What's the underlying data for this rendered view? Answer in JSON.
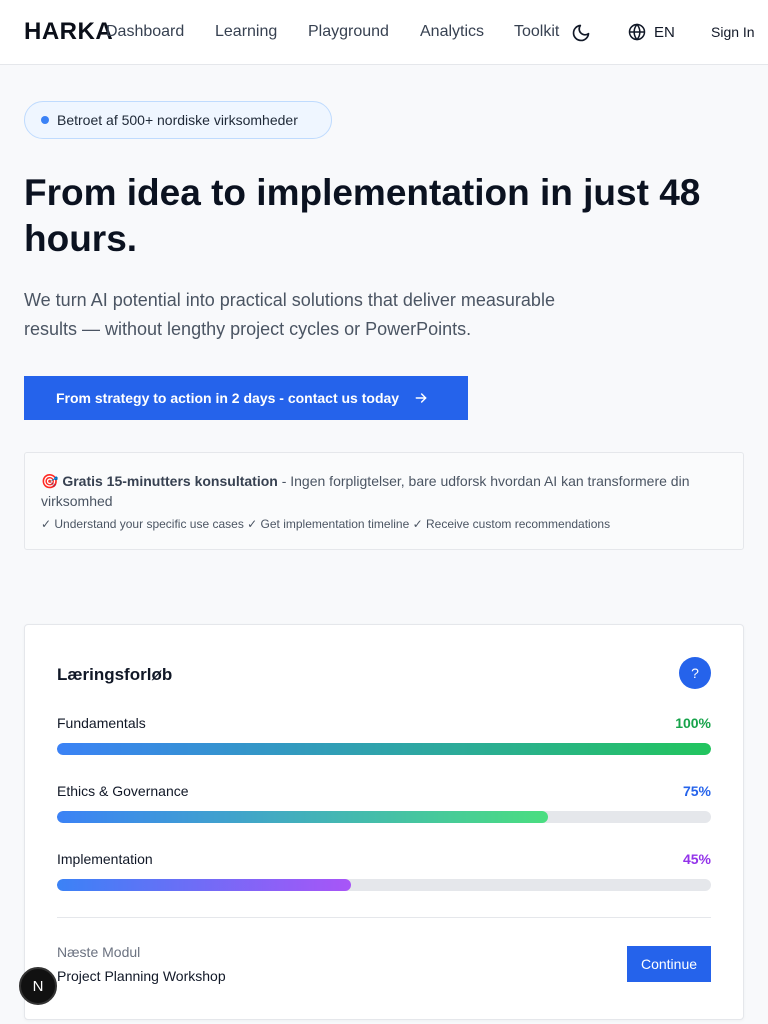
{
  "header": {
    "logo": "HARKA",
    "nav": [
      "Dashboard",
      "Learning",
      "Playground",
      "Analytics",
      "Toolkit"
    ],
    "theme_icon": "moon-icon",
    "language": "EN",
    "language_icon": "globe-icon",
    "sign_in": "Sign In"
  },
  "hero": {
    "badge": "Betroet af 500+ nordiske virksomheder",
    "title": "From idea to implementation in just 48 hours.",
    "subtitle": "We turn AI potential into practical solutions that deliver measurable results — without lengthy project cycles or PowerPoints.",
    "cta": "From strategy to action in 2 days - contact us today",
    "cta_icon": "arrow-right-icon"
  },
  "consultation": {
    "emoji": "🎯",
    "bold": "Gratis 15-minutters konsultation",
    "text": " - Ingen forpligtelser, bare udforsk hvordan AI kan transformere din virksomhed",
    "checks": "✓ Understand your specific use cases ✓ Get implementation timeline ✓ Receive custom recommendations"
  },
  "learning": {
    "title": "Læringsforløb",
    "help": "?",
    "modules": [
      {
        "label": "Fundamentals",
        "pct_text": "100%",
        "progress": 1.0,
        "pct_color": "#16a34a"
      },
      {
        "label": "Ethics & Governance",
        "pct_text": "75%",
        "progress": 0.75,
        "pct_color": "#2563eb"
      },
      {
        "label": "Implementation",
        "pct_text": "45%",
        "progress": 0.45,
        "pct_color": "#9333ea"
      }
    ],
    "next_label": "Næste Modul",
    "next_name": "Project Planning Workshop",
    "continue": "Continue"
  },
  "floating_badge": "N"
}
